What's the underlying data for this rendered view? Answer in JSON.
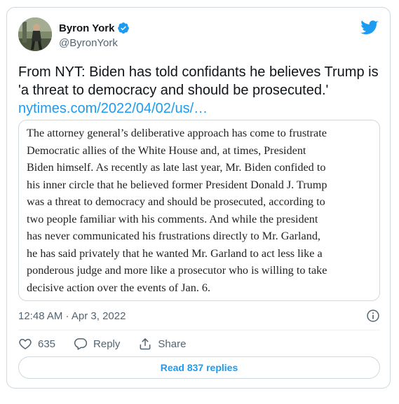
{
  "author": {
    "display_name": "Byron York",
    "handle": "@ByronYork",
    "verified": true
  },
  "tweet": {
    "text": "From NYT: Biden has told confidants he believes Trump is 'a threat to democracy and should be prosecuted.'",
    "link": "nytimes.com/2022/04/02/us/…"
  },
  "quote": {
    "lines": [
      "The attorney general’s deliberative approach has come to frustrate",
      "Democratic allies of the White House and, at times, President",
      "Biden himself. As recently as late last year, Mr. Biden confided to",
      "his inner circle that he believed former President Donald J. Trump",
      "was a threat to democracy and should be prosecuted, according to",
      "two people familiar with his comments. And while the president",
      "has never communicated his frustrations directly to Mr. Garland,",
      "he has said privately that he wanted Mr. Garland to act less like a",
      "ponderous judge and more like a prosecutor who is willing to take",
      "decisive action over the events of Jan. 6."
    ]
  },
  "meta": {
    "timestamp": "12:48 AM · Apr 3, 2022"
  },
  "actions": {
    "like_count": "635",
    "reply_label": "Reply",
    "share_label": "Share"
  },
  "replies_button": {
    "label": "Read 837 replies"
  },
  "icons": {
    "verified": "verified-badge-icon",
    "brand": "twitter-bird-icon",
    "info": "info-icon",
    "like": "heart-icon",
    "reply": "reply-bubble-icon",
    "share": "share-upload-icon"
  },
  "colors": {
    "accent": "#1d9bf0",
    "text_primary": "#0f1419",
    "text_secondary": "#536471",
    "border": "#cfd9de"
  }
}
